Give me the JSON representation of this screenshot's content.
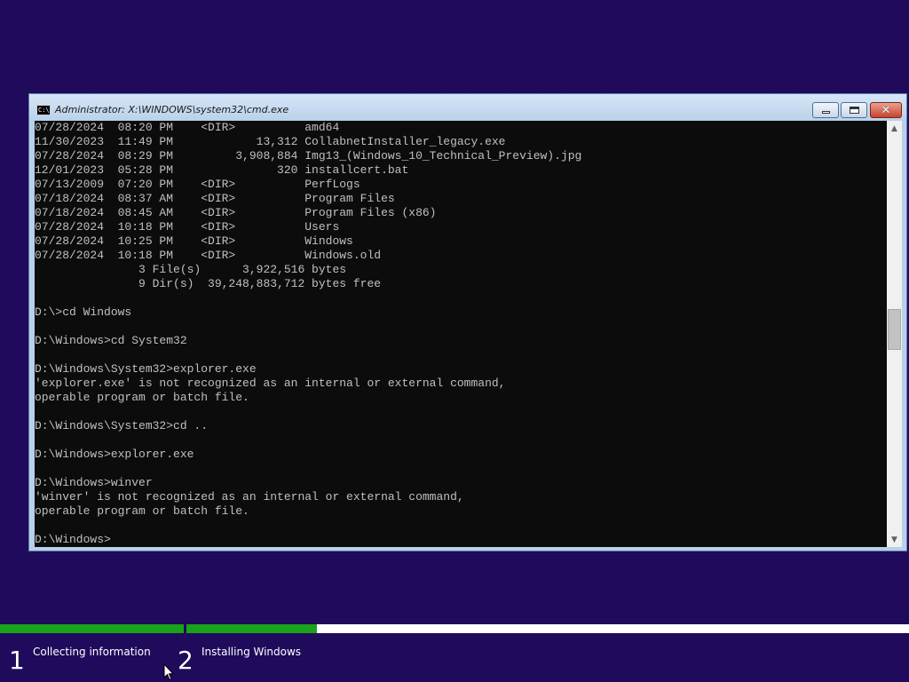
{
  "window": {
    "title": "Administrator: X:\\WINDOWS\\system32\\cmd.exe",
    "icon": "cmd-icon",
    "icon_text": "C:\\"
  },
  "console": {
    "lines": [
      "07/28/2024  08:20 PM    <DIR>          amd64",
      "11/30/2023  11:49 PM            13,312 CollabnetInstaller_legacy.exe",
      "07/28/2024  08:29 PM         3,908,884 Img13_(Windows_10_Technical_Preview).jpg",
      "12/01/2023  05:28 PM               320 installcert.bat",
      "07/13/2009  07:20 PM    <DIR>          PerfLogs",
      "07/18/2024  08:37 AM    <DIR>          Program Files",
      "07/18/2024  08:45 AM    <DIR>          Program Files (x86)",
      "07/28/2024  10:18 PM    <DIR>          Users",
      "07/28/2024  10:25 PM    <DIR>          Windows",
      "07/28/2024  10:18 PM    <DIR>          Windows.old",
      "               3 File(s)      3,922,516 bytes",
      "               9 Dir(s)  39,248,883,712 bytes free",
      "",
      "D:\\>cd Windows",
      "",
      "D:\\Windows>cd System32",
      "",
      "D:\\Windows\\System32>explorer.exe",
      "'explorer.exe' is not recognized as an internal or external command,",
      "operable program or batch file.",
      "",
      "D:\\Windows\\System32>cd ..",
      "",
      "D:\\Windows>explorer.exe",
      "",
      "D:\\Windows>winver",
      "'winver' is not recognized as an internal or external command,",
      "operable program or batch file.",
      "",
      "D:\\Windows>"
    ]
  },
  "setup": {
    "progress_step1": 1.0,
    "progress_step2": 0.18,
    "steps": [
      {
        "number": "1",
        "label": "Collecting information"
      },
      {
        "number": "2",
        "label": "Installing Windows"
      }
    ]
  },
  "colors": {
    "background": "#1f0a5c",
    "console_bg": "#0c0c0c",
    "console_text": "#c0c0c0",
    "progress_fill": "#1aa21a"
  }
}
